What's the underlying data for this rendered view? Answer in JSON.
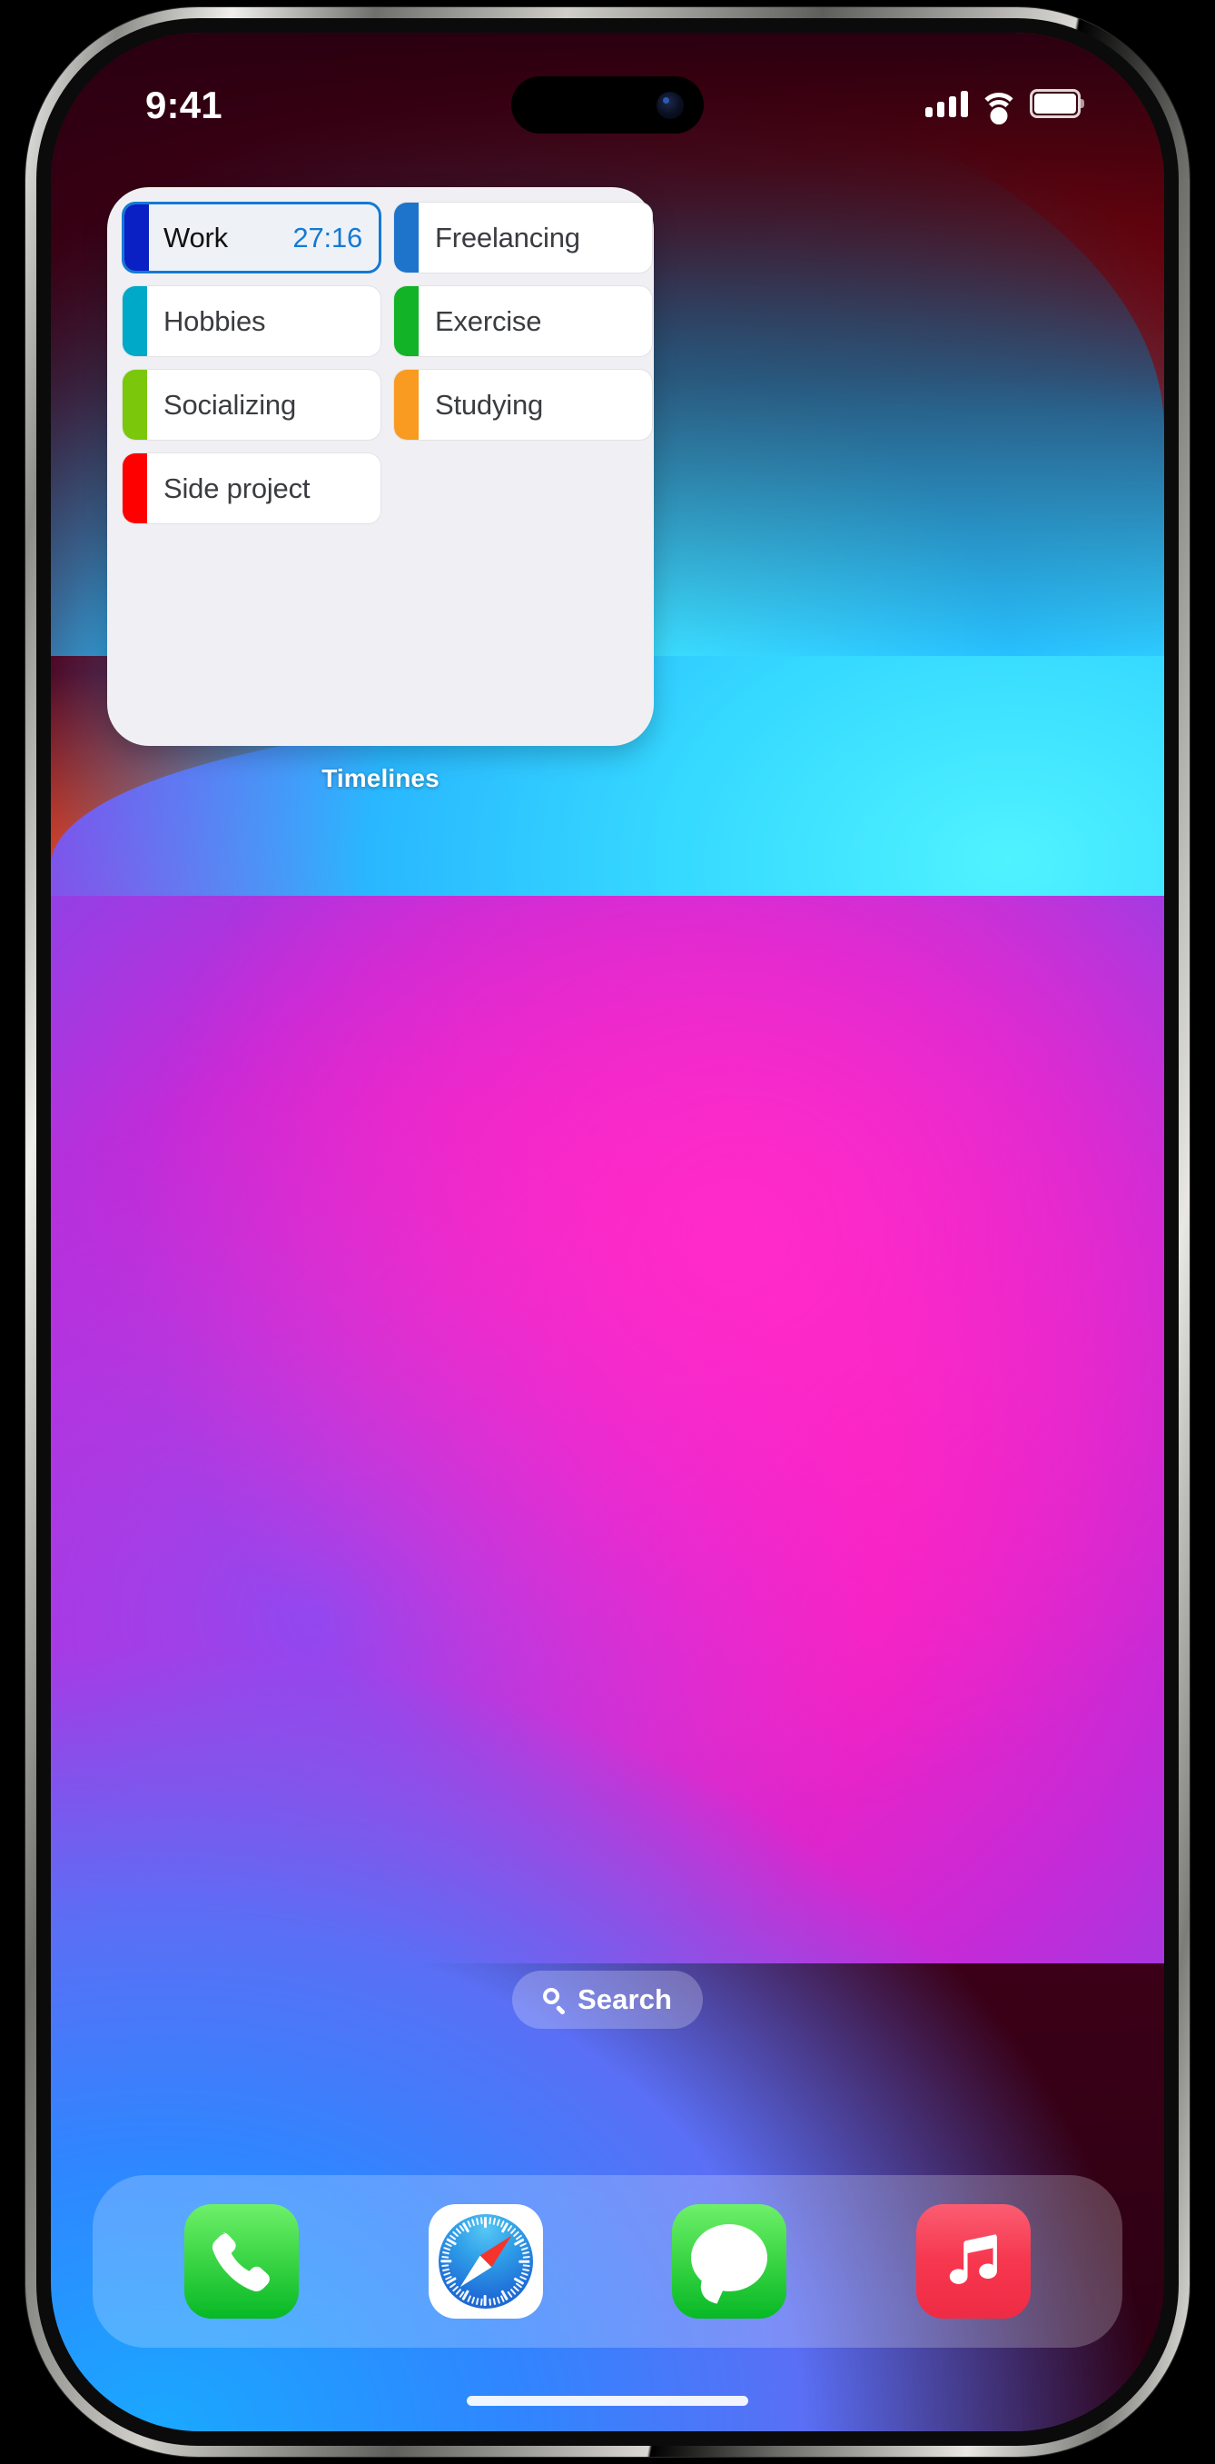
{
  "status_bar": {
    "time": "9:41",
    "signal_icon": "cellular-signal-icon",
    "signal_bars": 4,
    "wifi_icon": "wifi-icon",
    "battery_icon": "battery-icon",
    "battery_full": true
  },
  "widget": {
    "label": "Timelines",
    "background": "#f0f0f4",
    "rows": [
      {
        "name": "Work",
        "color": "#0a1fc4",
        "timer": "27:16",
        "selected": true
      },
      {
        "name": "Freelancing",
        "color": "#1d74ca",
        "timer": "",
        "selected": false
      },
      {
        "name": "Hobbies",
        "color": "#00a9c8",
        "timer": "",
        "selected": false
      },
      {
        "name": "Exercise",
        "color": "#12b327",
        "timer": "",
        "selected": false
      },
      {
        "name": "Socializing",
        "color": "#7ac70c",
        "timer": "",
        "selected": false
      },
      {
        "name": "Studying",
        "color": "#f99a21",
        "timer": "",
        "selected": false
      },
      {
        "name": "Side project",
        "color": "#ff0000",
        "timer": "",
        "selected": false
      }
    ],
    "selected_accent": "#1479d4"
  },
  "search": {
    "label": "Search",
    "icon": "magnifying-glass-icon"
  },
  "dock": {
    "apps": [
      {
        "name": "Phone",
        "icon": "phone-icon"
      },
      {
        "name": "Safari",
        "icon": "safari-compass-icon"
      },
      {
        "name": "Messages",
        "icon": "messages-bubble-icon"
      },
      {
        "name": "Music",
        "icon": "music-note-icon"
      }
    ]
  }
}
